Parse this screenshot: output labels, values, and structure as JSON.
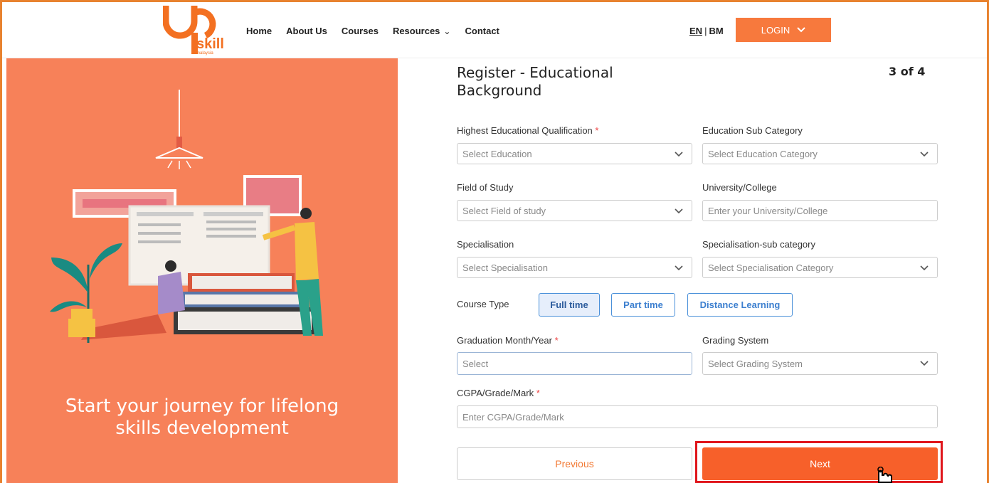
{
  "header": {
    "logo_text": "skill",
    "logo_subtext": "malaysia",
    "nav": {
      "home": "Home",
      "about": "About Us",
      "courses": "Courses",
      "resources": "Resources",
      "contact": "Contact"
    },
    "lang_en": "EN",
    "lang_sep": "|",
    "lang_bm": "BM",
    "login": "LOGIN"
  },
  "left_panel": {
    "tagline_line1": "Start your journey for lifelong",
    "tagline_line2": "skills development"
  },
  "form": {
    "title": "Register - Educational Background",
    "step": "3 of 4",
    "highest_qualification": {
      "label": "Highest Educational Qualification",
      "required": "*",
      "placeholder": "Select Education"
    },
    "education_sub": {
      "label": "Education Sub Category",
      "placeholder": "Select Education Category"
    },
    "field_of_study": {
      "label": "Field of Study",
      "placeholder": "Select Field of study"
    },
    "university": {
      "label": "University/College",
      "placeholder": "Enter your University/College"
    },
    "specialisation": {
      "label": "Specialisation",
      "placeholder": "Select Specialisation"
    },
    "specialisation_sub": {
      "label": "Specialisation-sub category",
      "placeholder": "Select Specialisation Category"
    },
    "course_type": {
      "label": "Course Type",
      "options": [
        "Full time",
        "Part time",
        "Distance Learning"
      ],
      "selected": "Full time"
    },
    "graduation": {
      "label": "Graduation Month/Year",
      "required": "*",
      "placeholder": "Select"
    },
    "grading": {
      "label": "Grading System",
      "placeholder": "Select Grading System"
    },
    "cgpa": {
      "label": "CGPA/Grade/Mark",
      "required": "*",
      "placeholder": "Enter CGPA/Grade/Mark"
    },
    "previous": "Previous",
    "next": "Next"
  },
  "colors": {
    "brand_orange": "#f7793d",
    "panel_orange": "#f78159",
    "next_button": "#f7602a",
    "highlight_red": "#e0161c",
    "course_type_blue": "#4a90d9"
  }
}
